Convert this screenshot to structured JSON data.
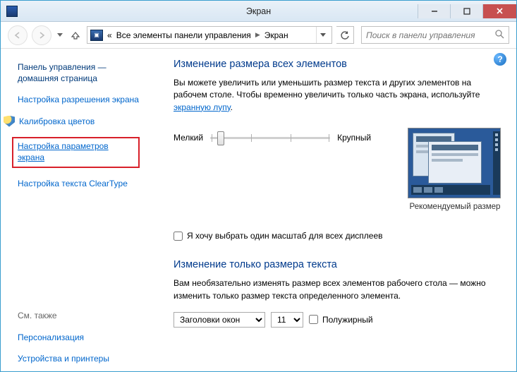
{
  "window": {
    "title": "Экран"
  },
  "nav": {
    "breadcrumb_root_icon": "control-panel-icon",
    "breadcrumb_sep": "«",
    "crumb1": "Все элементы панели управления",
    "crumb2": "Экран",
    "search_placeholder": "Поиск в панели управления"
  },
  "sidebar": {
    "home": "Панель управления — домашняя страница",
    "items": [
      "Настройка разрешения экрана",
      "Калибровка цветов",
      "Настройка параметров экрана",
      "Настройка текста ClearType"
    ],
    "see_also_header": "См. также",
    "see_also": [
      "Персонализация",
      "Устройства и принтеры"
    ]
  },
  "main": {
    "heading1": "Изменение размера всех элементов",
    "desc_pre": "Вы можете увеличить или уменьшить размер текста и других элементов на рабочем столе. Чтобы временно увеличить только часть экрана, используйте ",
    "desc_link": "экранную лупу",
    "desc_post": ".",
    "slider_min": "Мелкий",
    "slider_max": "Крупный",
    "preview_caption": "Рекомендуемый размер",
    "checkbox_label": "Я хочу выбрать один масштаб для всех дисплеев",
    "heading2": "Изменение только размера текста",
    "desc2": "Вам необязательно изменять размер всех элементов рабочего стола — можно изменить только размер текста определенного элемента.",
    "select_element_value": "Заголовки окон",
    "select_element_options": [
      "Заголовки окон"
    ],
    "select_size_value": "11",
    "select_size_options": [
      "11"
    ],
    "bold_label": "Полужирный"
  }
}
